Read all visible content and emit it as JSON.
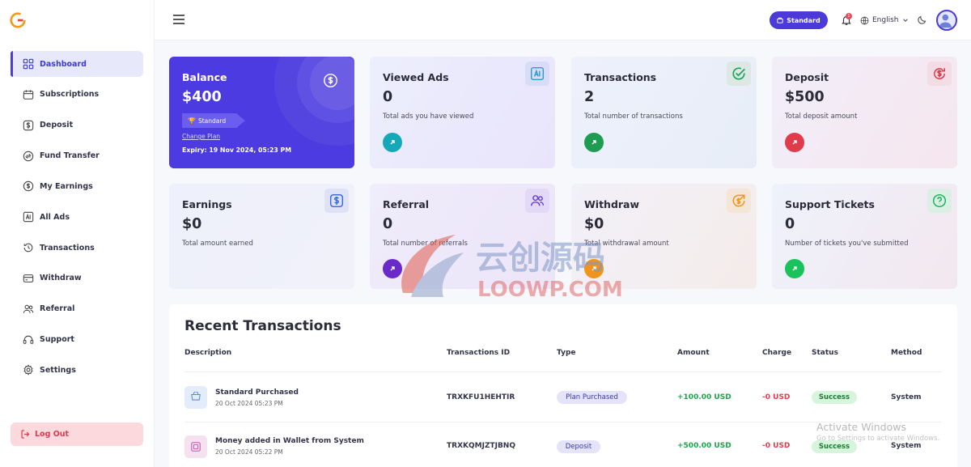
{
  "sidebar": {
    "items": [
      {
        "label": "Dashboard",
        "icon": "grid-icon"
      },
      {
        "label": "Subscriptions",
        "icon": "calendar-icon"
      },
      {
        "label": "Deposit",
        "icon": "dollar-icon"
      },
      {
        "label": "Fund Transfer",
        "icon": "transfer-icon"
      },
      {
        "label": "My Earnings",
        "icon": "dollar-circle-icon"
      },
      {
        "label": "All Ads",
        "icon": "ads-icon"
      },
      {
        "label": "Transactions",
        "icon": "history-icon"
      },
      {
        "label": "Withdraw",
        "icon": "withdraw-icon"
      },
      {
        "label": "Referral",
        "icon": "users-icon"
      },
      {
        "label": "Support",
        "icon": "support-icon"
      },
      {
        "label": "Settings",
        "icon": "gear-icon"
      }
    ],
    "logout_label": "Log Out"
  },
  "header": {
    "plan_label": "Standard",
    "notification_count": "1",
    "language": "English"
  },
  "cards": {
    "balance": {
      "title": "Balance",
      "value": "$400",
      "plan": "Standard",
      "change_plan": "Change Plan",
      "expiry": "Expiry: 19 Nov 2024, 05:23 PM"
    },
    "viewed_ads": {
      "title": "Viewed Ads",
      "value": "0",
      "desc": "Total ads you have viewed"
    },
    "transactions": {
      "title": "Transactions",
      "value": "2",
      "desc": "Total number of transactions"
    },
    "deposit": {
      "title": "Deposit",
      "value": "$500",
      "desc": "Total deposit amount"
    },
    "earnings": {
      "title": "Earnings",
      "value": "$0",
      "desc": "Total amount earned"
    },
    "referral": {
      "title": "Referral",
      "value": "0",
      "desc": "Total number of referrals"
    },
    "withdraw": {
      "title": "Withdraw",
      "value": "$0",
      "desc": "Total withdrawal amount"
    },
    "support": {
      "title": "Support Tickets",
      "value": "0",
      "desc": "Number of tickets you've submitted"
    }
  },
  "recent": {
    "title": "Recent Transactions",
    "columns": [
      "Description",
      "Transactions ID",
      "Type",
      "Amount",
      "Charge",
      "Status",
      "Method"
    ],
    "rows": [
      {
        "desc": "Standard Purchased",
        "date": "20 Oct 2024 05:23 PM",
        "id": "TRXKFU1HEHTIR",
        "type": "Plan Purchased",
        "amount": "+100.00 USD",
        "charge": "-0 USD",
        "status": "Success",
        "method": "System"
      },
      {
        "desc": "Money added in Wallet from System",
        "date": "20 Oct 2024 05:22 PM",
        "id": "TRXKQMJZTJBNQ",
        "type": "Deposit",
        "amount": "+500.00 USD",
        "charge": "-0 USD",
        "status": "Success",
        "method": "System"
      }
    ]
  },
  "overlay": {
    "activate_title": "Activate Windows",
    "activate_sub": "Go to Settings to activate Windows.",
    "watermark_cn": "云创源码",
    "watermark_en": "LOOWP.COM"
  },
  "colors": {
    "accent": "#4b39d8",
    "danger": "#e03b4d",
    "success": "#18a84a"
  }
}
